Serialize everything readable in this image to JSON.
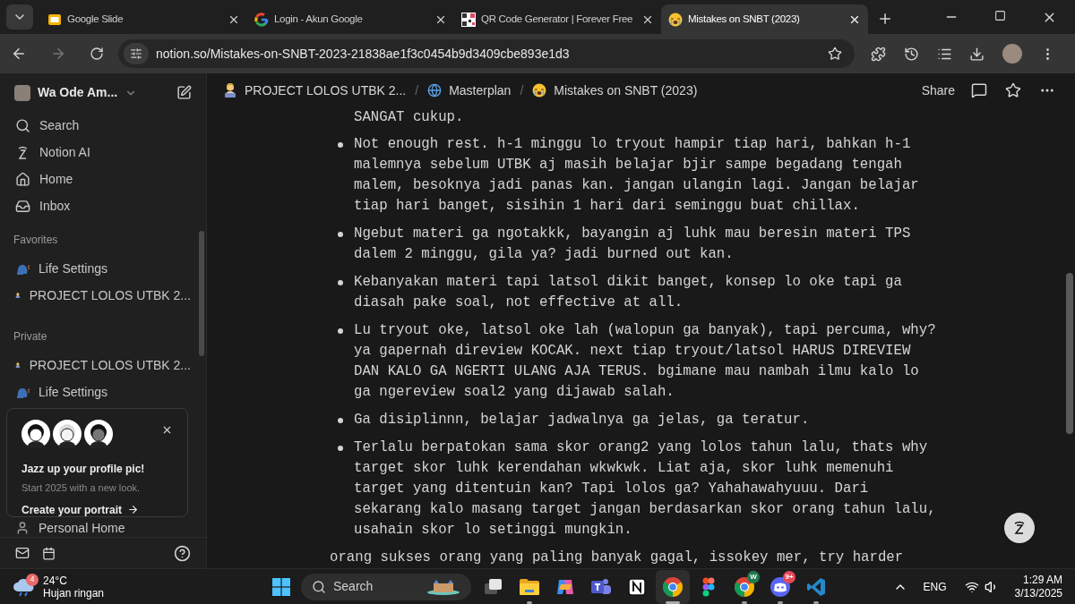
{
  "browser": {
    "tabs": [
      {
        "title": "Google Slide",
        "kind": "slides",
        "selected": false
      },
      {
        "title": "Login - Akun Google",
        "kind": "google",
        "selected": false
      },
      {
        "title": "QR Code Generator | Forever Free",
        "kind": "qr",
        "selected": false
      },
      {
        "title": "Mistakes on SNBT (2023)",
        "kind": "crying",
        "selected": true
      }
    ],
    "url": "notion.so/Mistakes-on-SNBT-2023-21838ae1f3c0454b9d3409cbe893e1d3"
  },
  "sidebar": {
    "workspace": "Wa Ode Am...",
    "nav": [
      {
        "label": "Search",
        "kind": "search"
      },
      {
        "label": "Notion AI",
        "kind": "ai"
      },
      {
        "label": "Home",
        "kind": "home"
      },
      {
        "label": "Inbox",
        "kind": "inbox"
      }
    ],
    "sections": [
      {
        "title": "Favorites",
        "items": [
          {
            "label": "Life Settings",
            "kind": "head"
          },
          {
            "label": "PROJECT LOLOS UTBK 2...",
            "kind": "laptop"
          }
        ]
      },
      {
        "title": "Private",
        "items": [
          {
            "label": "PROJECT LOLOS UTBK 2...",
            "kind": "laptop"
          },
          {
            "label": "Life Settings",
            "kind": "head"
          },
          {
            "label": "Personal Home",
            "kind": "person"
          }
        ]
      }
    ],
    "promo": {
      "title": "Jazz up your profile pic!",
      "subtitle": "Start 2025 with a new look.",
      "cta": "Create your portrait"
    }
  },
  "breadcrumb": [
    {
      "label": "PROJECT LOLOS UTBK 2...",
      "kind": "laptop"
    },
    {
      "separator": "/",
      "label": "Masterplan",
      "kind": "globe"
    },
    {
      "separator": "/",
      "label": "Mistakes on SNBT (2023)",
      "kind": "crying"
    }
  ],
  "share": "Share",
  "content": {
    "lead": "SANGAT cukup.",
    "bullets": [
      "Not enough rest. h-1 minggu lo tryout hampir tiap hari, bahkan h-1 malemnya sebelum UTBK aj masih belajar bjir sampe begadang tengah malem, besoknya jadi panas kan. jangan ulangin lagi. Jangan belajar tiap hari banget, sisihin 1 hari dari seminggu buat chillax.",
      "Ngebut materi ga ngotakkk, bayangin aj luhk mau beresin materi TPS dalem 2 minggu, gila ya? jadi burned out kan.",
      "Kebanyakan materi tapi latsol dikit banget, konsep lo oke tapi ga diasah pake soal, not effective at all.",
      "Lu tryout oke, latsol oke lah (walopun ga banyak), tapi percuma, why? ya gapernah direview KOCAK. next tiap tryout/latsol HARUS DIREVIEW DAN KALO GA NGERTI ULANG AJA TERUS. bgimane mau nambah ilmu kalo lo ga ngereview soal2 yang dijawab salah.",
      "Ga disiplinnn, belajar jadwalnya ga jelas, ga teratur.",
      "Terlalu berpatokan sama skor orang2 yang lolos tahun lalu, thats why target skor luhk kerendahan wkwkwk. Liat aja, skor luhk memenuhi target yang ditentuin kan? Tapi lolos ga? Yahahawahyuuu. Dari sekarang kalo masang target jangan berdasarkan skor orang tahun lalu, usahain skor lo setinggi mungkin."
    ],
    "closing": "orang sukses orang yang paling banyak gagal, issokey mer, try harder"
  },
  "taskbar": {
    "weather": {
      "temp": "24°C",
      "desc": "Hujan ringan",
      "badge": "4"
    },
    "search": "Search",
    "apps": [
      {
        "kind": "taskview",
        "running": false,
        "active": false
      },
      {
        "kind": "explorer",
        "running": true,
        "active": false
      },
      {
        "kind": "copilot",
        "running": false,
        "active": false
      },
      {
        "kind": "teams",
        "running": false,
        "active": false
      },
      {
        "kind": "notion",
        "running": false,
        "active": false
      },
      {
        "kind": "chrome",
        "running": true,
        "active": true
      },
      {
        "kind": "figma",
        "running": false,
        "active": false
      },
      {
        "kind": "chrome",
        "running": true,
        "active": false,
        "badge": "W"
      },
      {
        "kind": "discord",
        "running": true,
        "active": false,
        "badge": "9+"
      },
      {
        "kind": "vscode",
        "running": true,
        "active": false
      }
    ],
    "lang": "ENG",
    "time": "1:29 AM",
    "date": "3/13/2025"
  }
}
